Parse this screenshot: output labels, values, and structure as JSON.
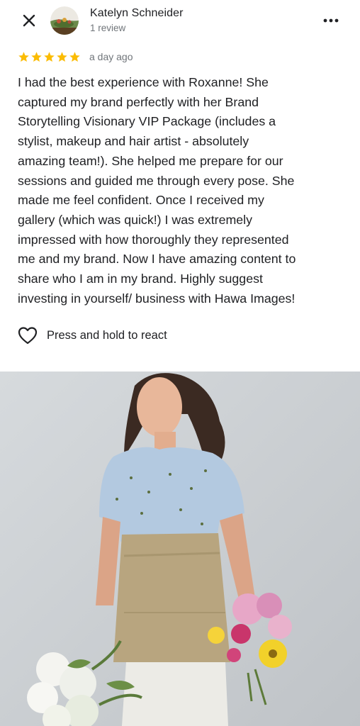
{
  "review": {
    "author_name": "Katelyn Schneider",
    "author_reviews": "1 review",
    "rating": 5,
    "rating_max": 5,
    "date": "a day ago",
    "text": "I had the best experience with Roxanne! She\ncaptured my brand perfectly with her Brand\nStorytelling Visionary VIP Package (includes a\nstylist, makeup and hair artist - absolutely\namazing team!). She helped me prepare for our\nsessions and guided me through every pose. She\nmade me feel confident. Once I received my\ngallery (which was quick!) I was extremely\nimpressed with how thoroughly they represented\nme and my brand.  Now I have amazing content to\nshare who I am in my brand. Highly suggest\ninvesting in yourself/ business with Hawa Images!"
  },
  "actions": {
    "react_label": "Press and hold to react"
  },
  "icons": {
    "close": "close-icon",
    "more": "more-vert-icon",
    "star": "star-icon",
    "heart": "heart-outline-icon"
  },
  "colors": {
    "star": "#fbbc04",
    "text_primary": "#202124",
    "text_secondary": "#70757a"
  }
}
